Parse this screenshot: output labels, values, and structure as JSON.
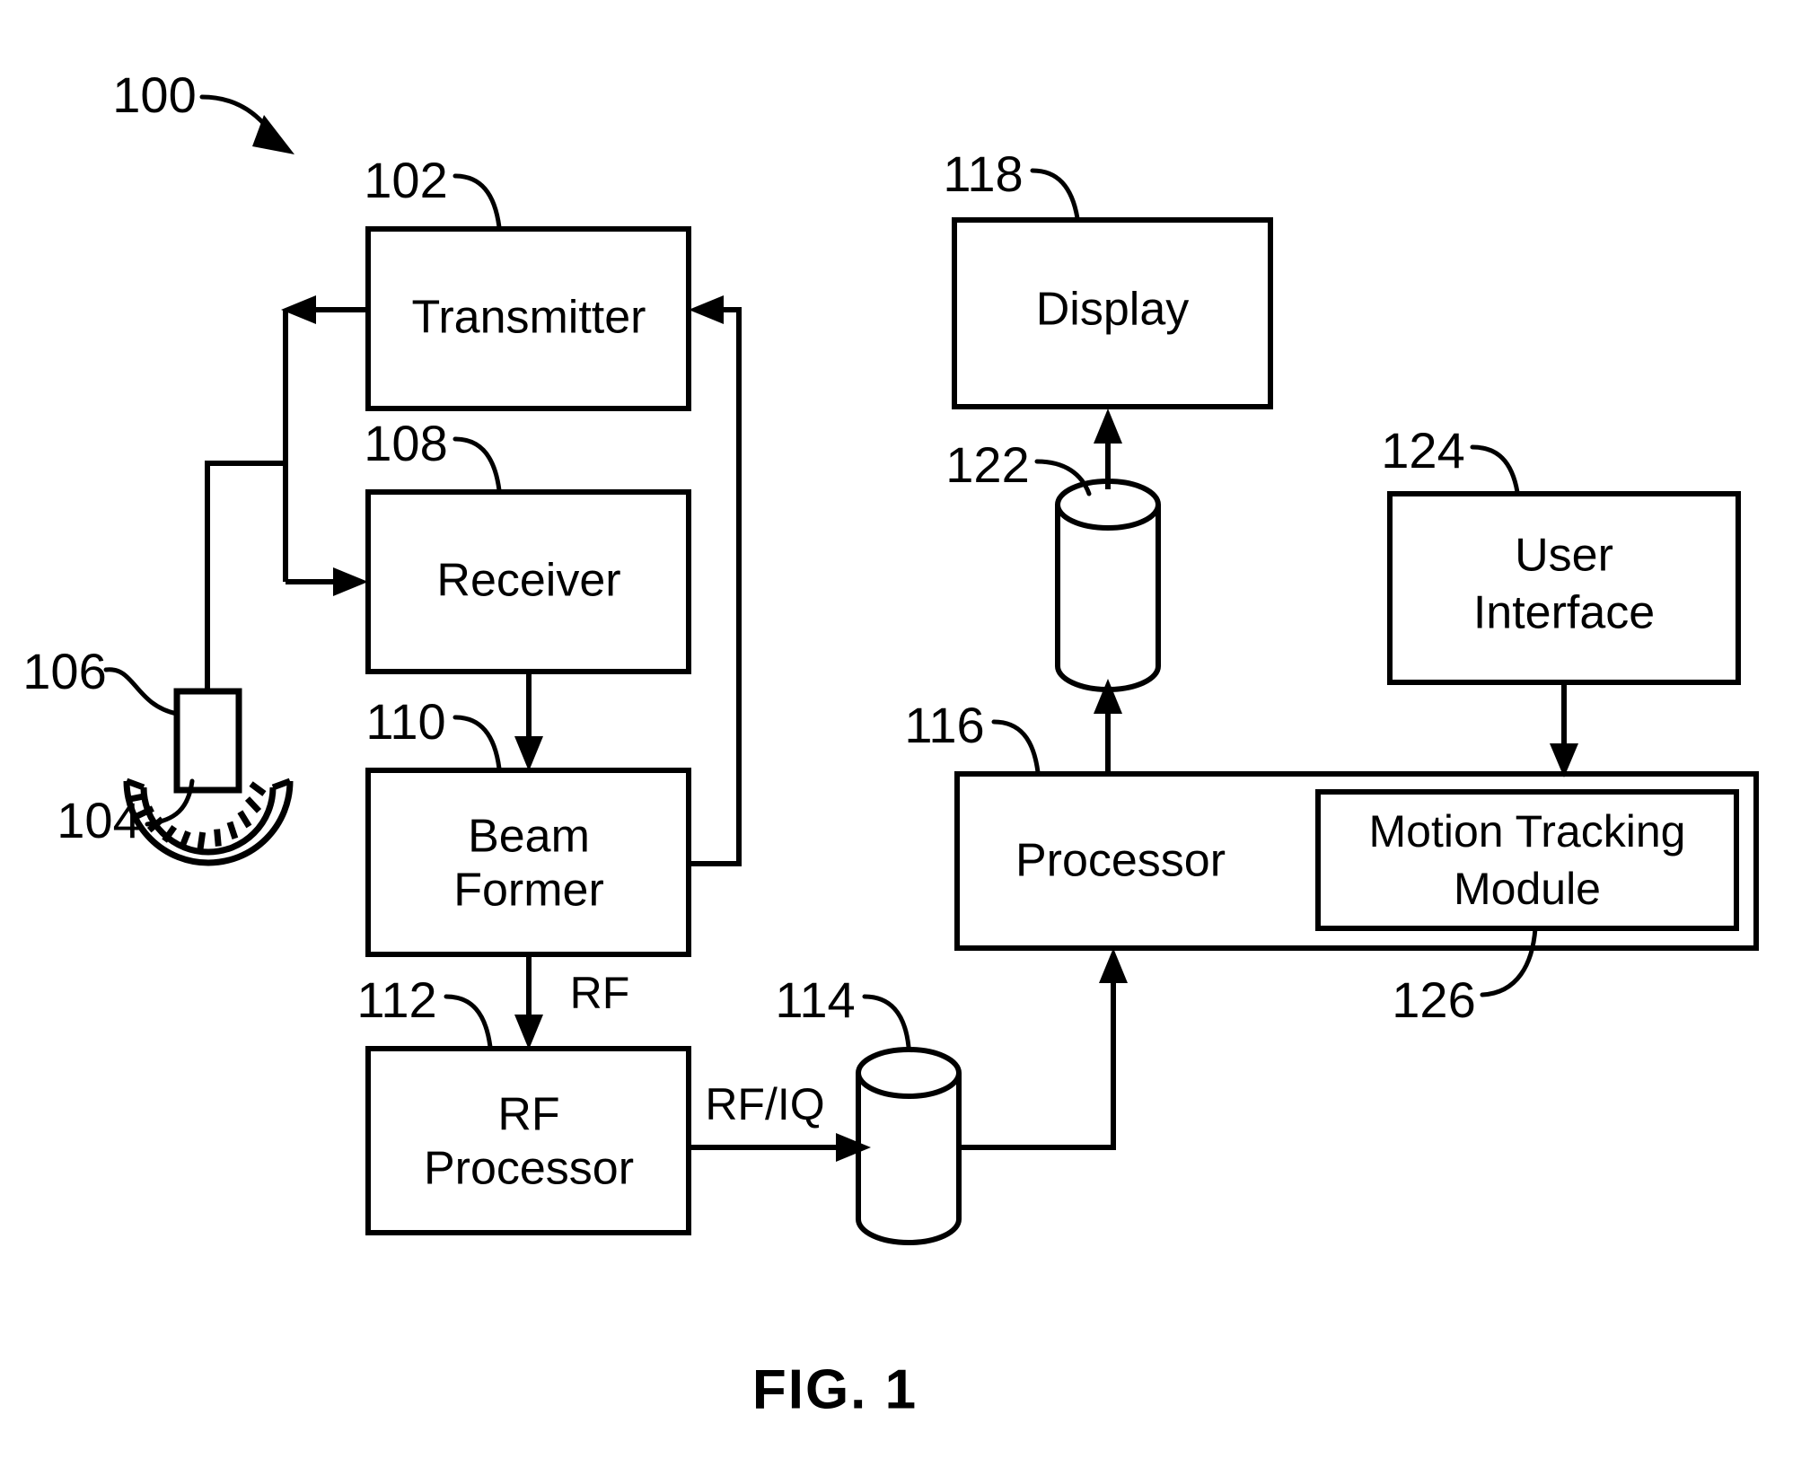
{
  "figure": {
    "caption": "FIG. 1",
    "system_ref": "100",
    "title_text": "FIG. 1"
  },
  "blocks": [
    {
      "id": "transmitter",
      "ref": "102",
      "lines": [
        "Transmitter"
      ],
      "shape": "rectangle"
    },
    {
      "id": "receiver",
      "ref": "108",
      "lines": [
        "Receiver"
      ],
      "shape": "rectangle"
    },
    {
      "id": "beam-former",
      "ref": "110",
      "lines": [
        "Beam",
        "Former"
      ],
      "shape": "rectangle"
    },
    {
      "id": "rf-processor",
      "ref": "112",
      "lines": [
        "RF",
        "Processor"
      ],
      "shape": "rectangle"
    },
    {
      "id": "rf-iq-buffer",
      "ref": "114",
      "lines": [],
      "shape": "cylinder"
    },
    {
      "id": "processor",
      "ref": "116",
      "lines": [
        "Processor"
      ],
      "shape": "rectangle"
    },
    {
      "id": "display",
      "ref": "118",
      "lines": [
        "Display"
      ],
      "shape": "rectangle"
    },
    {
      "id": "image-buffer",
      "ref": "122",
      "lines": [],
      "shape": "cylinder"
    },
    {
      "id": "user-interface",
      "ref": "124",
      "lines": [
        "User",
        "Interface"
      ],
      "shape": "rectangle"
    },
    {
      "id": "motion-tracking-module",
      "ref": "126",
      "lines": [
        "Motion Tracking",
        "Module"
      ],
      "shape": "rectangle-inner"
    },
    {
      "id": "probe",
      "ref": "106",
      "lines": [],
      "shape": "probe"
    },
    {
      "id": "transducer-array",
      "ref": "104",
      "lines": [],
      "shape": "curved-array"
    }
  ],
  "labels": {
    "transmitter": "Transmitter",
    "receiver": "Receiver",
    "beam_former_line1": "Beam",
    "beam_former_line2": "Former",
    "rf_processor_line1": "RF",
    "rf_processor_line2": "Processor",
    "processor": "Processor",
    "display": "Display",
    "user_interface_line1": "User",
    "user_interface_line2": "Interface",
    "motion_tracking_line1": "Motion Tracking",
    "motion_tracking_line2": "Module"
  },
  "reference_numerals": {
    "system": "100",
    "transmitter": "102",
    "transducer_array": "104",
    "probe": "106",
    "receiver": "108",
    "beam_former": "110",
    "rf_processor": "112",
    "rf_iq_buffer": "114",
    "processor": "116",
    "display": "118",
    "image_buffer": "122",
    "user_interface": "124",
    "motion_tracking_module": "126"
  },
  "signal_labels": {
    "rf": "RF",
    "rf_iq": "RF/IQ"
  },
  "connections": [
    {
      "from": "transmitter",
      "to": "probe",
      "label": ""
    },
    {
      "from": "probe",
      "to": "receiver",
      "label": ""
    },
    {
      "from": "receiver",
      "to": "beam-former",
      "label": ""
    },
    {
      "from": "beam-former",
      "to": "transmitter",
      "label": ""
    },
    {
      "from": "beam-former",
      "to": "rf-processor",
      "label": "RF"
    },
    {
      "from": "rf-processor",
      "to": "rf-iq-buffer",
      "label": "RF/IQ"
    },
    {
      "from": "rf-iq-buffer",
      "to": "processor",
      "label": ""
    },
    {
      "from": "processor",
      "to": "image-buffer",
      "label": ""
    },
    {
      "from": "image-buffer",
      "to": "display",
      "label": ""
    },
    {
      "from": "user-interface",
      "to": "processor",
      "label": ""
    }
  ],
  "colors": {
    "line": "#000000",
    "fill": "#ffffff",
    "text": "#000000"
  }
}
